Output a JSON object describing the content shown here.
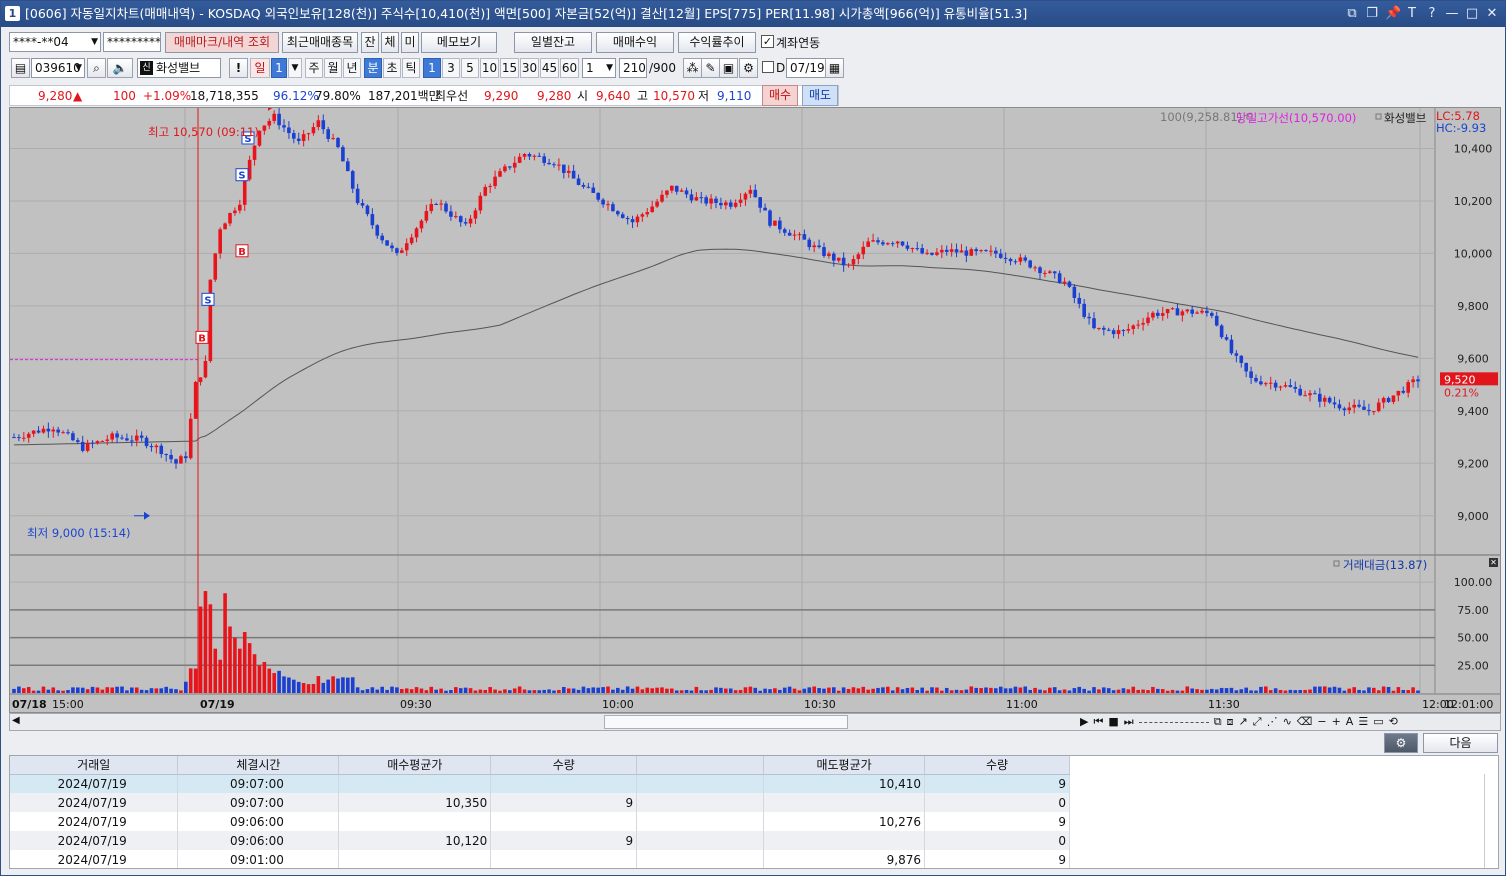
{
  "title_bar": {
    "window_id": "1",
    "text": "[0606] 자동일지차트(매매내역) - KOSDAQ 외국인보유[128(천)] 주식수[10,410(천)] 액면[500] 자본금[52(억)] 결산[12월] EPS[775] PER[11.98] 시가총액[966(억)] 유통비율[51.3]",
    "buttons": [
      "⧉",
      "❐",
      "📌",
      "T",
      "?",
      "—",
      "□",
      "✕"
    ]
  },
  "toolbar1": {
    "account": "****-**04",
    "password": "*********",
    "btn_trade_marks": "매매마크/내역 조회",
    "btn_recent": "최근매매종목",
    "chips": [
      "잔",
      "체",
      "미"
    ],
    "btn_memo": "메모보기",
    "btn_daily_balance": "일별잔고",
    "btn_trade_profit": "매매수익",
    "btn_return_trend": "수익률추이",
    "link_account_label": "계좌연동",
    "link_account_checked": true
  },
  "toolbar2": {
    "code": "039610",
    "stock_name": "화성밸브",
    "period_units": [
      "일",
      "1",
      "주",
      "월",
      "년",
      "분",
      "초",
      "틱"
    ],
    "minute_units": [
      "1",
      "3",
      "5",
      "10",
      "15",
      "30",
      "45",
      "60"
    ],
    "interval": "1",
    "count": "210",
    "count_max": "/900",
    "d_label": "D",
    "date": "07/19"
  },
  "quote": {
    "price": "9,280",
    "change_arrow": "▲",
    "change": "100",
    "change_pct": "+1.09%",
    "volume": "18,718,355",
    "ratio1": "96.12%",
    "ratio2": "79.80%",
    "amount": "187,201백만",
    "best_label": "최우선",
    "best_ask": "9,290",
    "best_bid": "9,280",
    "open_label": "시",
    "open": "9,640",
    "high_label": "고",
    "high": "10,570",
    "low_label": "저",
    "low": "9,110",
    "buy_label": "매수",
    "sell_label": "매도"
  },
  "chart": {
    "legend_ma": "100(9,258.81)",
    "legend_high_line": "당일고가선(10,570.00)",
    "legend_stock": "화성밸브",
    "lc_label": "LC:5.78",
    "hc_label": "HC:-9.93",
    "high_annotation": "최고 10,570 (09:11)",
    "low_annotation": "최저 9,000 (15:14)",
    "current_price_tag": "9,520",
    "current_pct_tag": "0.21%",
    "volume_legend": "거래대금(13.87)",
    "price_axis": [
      "10,400",
      "10,200",
      "10,000",
      "9,800",
      "9,600",
      "9,400",
      "9,200",
      "9,000"
    ],
    "volume_axis": [
      "100.00",
      "75.00",
      "50.00",
      "25.00"
    ],
    "time_axis": [
      "07/18",
      "15:00",
      "07/19",
      "09:30",
      "10:00",
      "10:30",
      "11:00",
      "11:30",
      "12:00",
      "12:01:00"
    ],
    "trade_marks": [
      {
        "type": "B"
      },
      {
        "type": "S"
      },
      {
        "type": "B"
      },
      {
        "type": "S"
      },
      {
        "type": "S"
      }
    ],
    "colors": {
      "up": "#e8141c",
      "down": "#1a3fd1",
      "ma": "#555555",
      "high_line": "#e020e0",
      "bg": "#c1c1c1"
    }
  },
  "chart_data": {
    "type": "candlestick",
    "x_range": [
      "07/18 14:49",
      "07/19 12:01"
    ],
    "y_range": [
      8900,
      10600
    ],
    "y_ticks": [
      9000,
      9200,
      9400,
      9600,
      9800,
      10000,
      10200,
      10400
    ],
    "day_high": {
      "value": 10570,
      "time": "09:11"
    },
    "day_low": {
      "value": 9000,
      "time": "15:14"
    },
    "last_close": 9520,
    "ma100_last": 9258.81,
    "volume_y_ticks": [
      25,
      50,
      75,
      100
    ],
    "volume_indicator": "거래대금(13.87)"
  },
  "scrollbar": {},
  "bottom_controls": {
    "next_label": "다음"
  },
  "table": {
    "headers": [
      "거래일",
      "체결시간",
      "매수평균가",
      "수량",
      "",
      "매도평균가",
      "수량"
    ],
    "rows": [
      [
        "2024/07/19",
        "09:07:00",
        "",
        "",
        "",
        "10,410",
        "9"
      ],
      [
        "2024/07/19",
        "09:07:00",
        "10,350",
        "9",
        "",
        "",
        "0"
      ],
      [
        "2024/07/19",
        "09:06:00",
        "",
        "",
        "",
        "10,276",
        "9"
      ],
      [
        "2024/07/19",
        "09:06:00",
        "10,120",
        "9",
        "",
        "",
        "0"
      ],
      [
        "2024/07/19",
        "09:01:00",
        "",
        "",
        "",
        "9,876",
        "9"
      ]
    ]
  }
}
